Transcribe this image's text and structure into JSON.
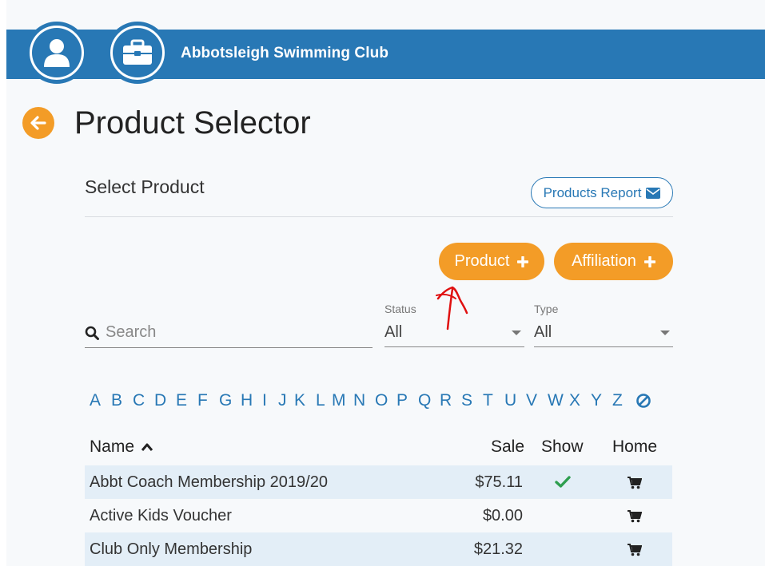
{
  "header": {
    "club_name": "Abbotsleigh Swimming Club",
    "avatar_icon": "user-icon",
    "org_icon": "briefcase-icon",
    "bar_color": "#2878b5"
  },
  "page": {
    "title": "Product Selector",
    "back_icon": "arrow-left-icon",
    "accent_color": "#f39c27"
  },
  "section": {
    "title": "Select Product",
    "report_button": "Products Report",
    "report_icon": "envelope-icon"
  },
  "actions": {
    "product_button": "Product",
    "affiliation_button": "Affiliation",
    "plus_icon": "plus-icon"
  },
  "filters": {
    "search_placeholder": "Search",
    "status_label": "Status",
    "status_value": "All",
    "type_label": "Type",
    "type_value": "All"
  },
  "alphabet": [
    "A",
    "B",
    "C",
    "D",
    "E",
    "F",
    "G",
    "H",
    "I",
    "J",
    "K",
    "L",
    "M",
    "N",
    "O",
    "P",
    "Q",
    "R",
    "S",
    "T",
    "U",
    "V",
    "W",
    "X",
    "Y",
    "Z"
  ],
  "table": {
    "headers": {
      "name": "Name",
      "sale": "Sale",
      "show": "Show",
      "home": "Home"
    },
    "rows": [
      {
        "name": "Abbt Coach Membership 2019/20",
        "sale": "$75.11",
        "show": true,
        "home": "cart-icon"
      },
      {
        "name": "Active Kids Voucher",
        "sale": "$0.00",
        "show": false,
        "home": "cart-icon"
      },
      {
        "name": "Club Only Membership",
        "sale": "$21.32",
        "show": false,
        "home": "cart-icon"
      }
    ]
  }
}
